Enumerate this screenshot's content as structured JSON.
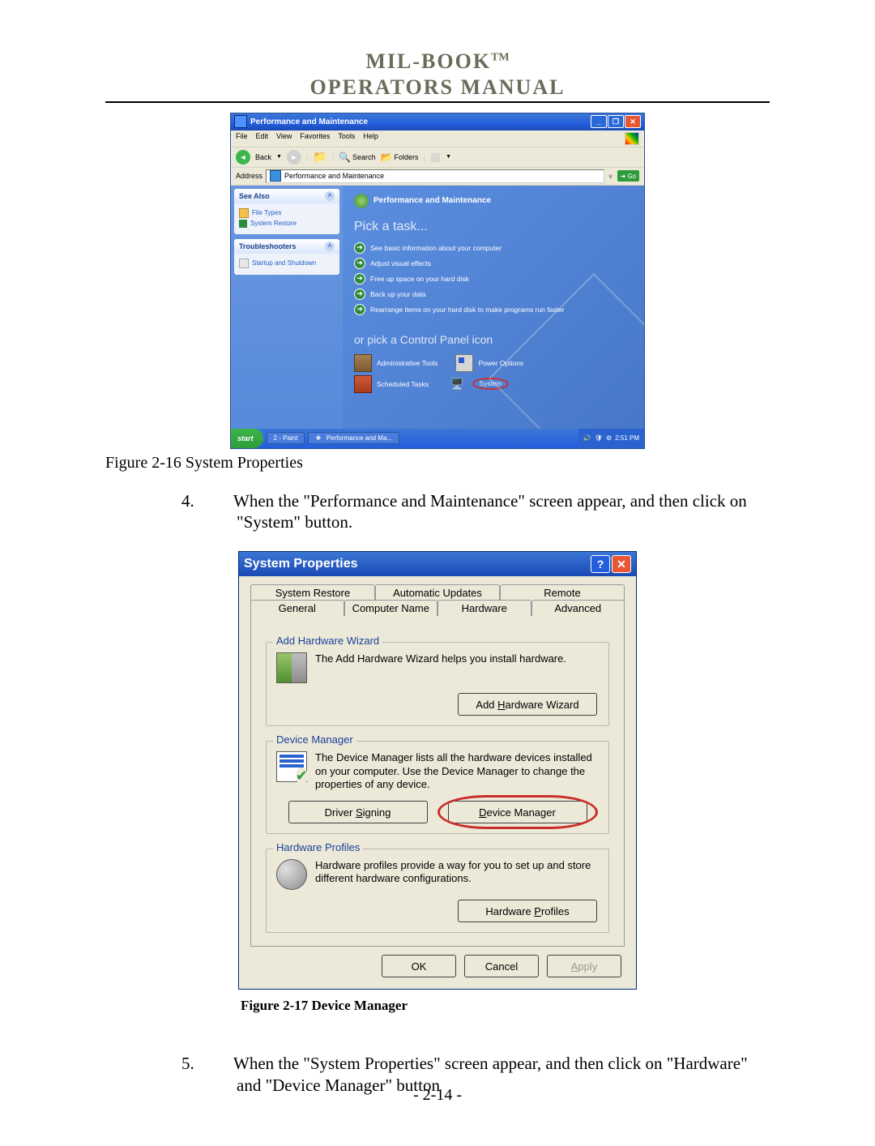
{
  "header": {
    "brand": "MIL-BOOK",
    "tm": "TM",
    "subtitle": "OPERATORS MANUAL"
  },
  "fig16": {
    "caption": "Figure 2-16 System Properties",
    "window_title": "Performance and Maintenance",
    "menu": [
      "File",
      "Edit",
      "View",
      "Favorites",
      "Tools",
      "Help"
    ],
    "toolbar": {
      "back": "Back",
      "search": "Search",
      "folders": "Folders"
    },
    "address_label": "Address",
    "address_value": "Performance and Maintenance",
    "go_label": "Go",
    "side_see_also": {
      "title": "See Also",
      "items": [
        "File Types",
        "System Restore"
      ]
    },
    "side_trouble": {
      "title": "Troubleshooters",
      "items": [
        "Startup and Shutdown"
      ]
    },
    "main_header": "Performance and Maintenance",
    "pick_task": "Pick a task...",
    "tasks": [
      "See basic information about your computer",
      "Adjust visual effects",
      "Free up space on your hard disk",
      "Back up your data",
      "Rearrange items on your hard disk to make programs run faster"
    ],
    "or_pick": "or pick a Control Panel icon",
    "cp_icons": {
      "admin": "Administrative Tools",
      "power": "Power Options",
      "sched": "Scheduled Tasks",
      "system": "System"
    },
    "taskbar": {
      "start": "start",
      "task1": "2 - Paint",
      "task2": "Performance and Ma...",
      "clock": "2:51 PM"
    }
  },
  "step4": {
    "num": "4.",
    "text": "When the \"Performance and Maintenance\" screen appear, and then click on \"System\" button."
  },
  "sp": {
    "title": "System Properties",
    "tabs_row1": [
      "System Restore",
      "Automatic Updates",
      "Remote"
    ],
    "tabs_row2": [
      "General",
      "Computer Name",
      "Hardware",
      "Advanced"
    ],
    "groups": {
      "add_hw": {
        "legend": "Add Hardware Wizard",
        "text": "The Add Hardware Wizard helps you install hardware.",
        "btn": "Add Hardware Wizard"
      },
      "dev_mgr": {
        "legend": "Device Manager",
        "text": "The Device Manager lists all the hardware devices installed on your computer. Use the Device Manager to change the properties of any device.",
        "btn1": "Driver Signing",
        "btn2": "Device Manager"
      },
      "hw_prof": {
        "legend": "Hardware Profiles",
        "text": "Hardware profiles provide a way for you to set up and store different hardware configurations.",
        "btn": "Hardware Profiles"
      }
    },
    "actions": {
      "ok": "OK",
      "cancel": "Cancel",
      "apply": "Apply"
    }
  },
  "fig17_caption": "Figure 2-17 Device Manager",
  "step5": {
    "num": "5.",
    "text": "When the \"System Properties\" screen appear, and then click on \"Hardware\" and \"Device Manager\" button"
  },
  "page_number": "- 2-14 -"
}
